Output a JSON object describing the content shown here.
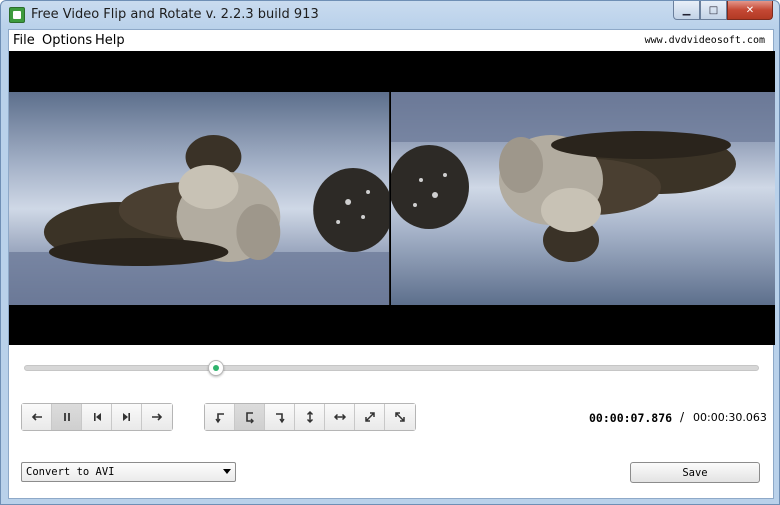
{
  "window": {
    "title": "Free Video Flip and Rotate v. 2.2.3 build 913",
    "controls": {
      "minimize": "▁",
      "maximize": "□",
      "close": "✕"
    }
  },
  "menu": {
    "items": [
      "File",
      "Options",
      "Help"
    ],
    "site": "www.dvdvideosoft.com"
  },
  "video": {
    "left_pane": "original-preview",
    "right_pane": "flipped-preview"
  },
  "timeline": {
    "position_fraction": 0.26
  },
  "playback_buttons": [
    {
      "name": "rewind-button",
      "icon": "arrow-left-icon"
    },
    {
      "name": "pause-button",
      "icon": "pause-icon",
      "active": true
    },
    {
      "name": "previous-frame-button",
      "icon": "skip-back-icon"
    },
    {
      "name": "next-frame-button",
      "icon": "skip-forward-icon"
    },
    {
      "name": "forward-button",
      "icon": "arrow-right-icon"
    }
  ],
  "transform_buttons": [
    {
      "name": "rotate-left-button",
      "icon": "rotate-left-icon"
    },
    {
      "name": "rotate-180-button",
      "icon": "rotate-180-icon",
      "active": true
    },
    {
      "name": "rotate-right-button",
      "icon": "rotate-right-icon"
    },
    {
      "name": "flip-vertical-button",
      "icon": "flip-vertical-icon"
    },
    {
      "name": "flip-horizontal-button",
      "icon": "flip-horizontal-icon"
    },
    {
      "name": "transpose-button",
      "icon": "diagonal-arrow-icon"
    },
    {
      "name": "transverse-button",
      "icon": "diagonal-arrow-reverse-icon"
    }
  ],
  "time": {
    "current": "00:00:07.876",
    "separator": "/",
    "total": "00:00:30.063"
  },
  "output": {
    "format_selected": "Convert to AVI",
    "save_label": "Save"
  },
  "colors": {
    "accent": "#2fb36d",
    "titlebar": "#b9d1ea"
  }
}
